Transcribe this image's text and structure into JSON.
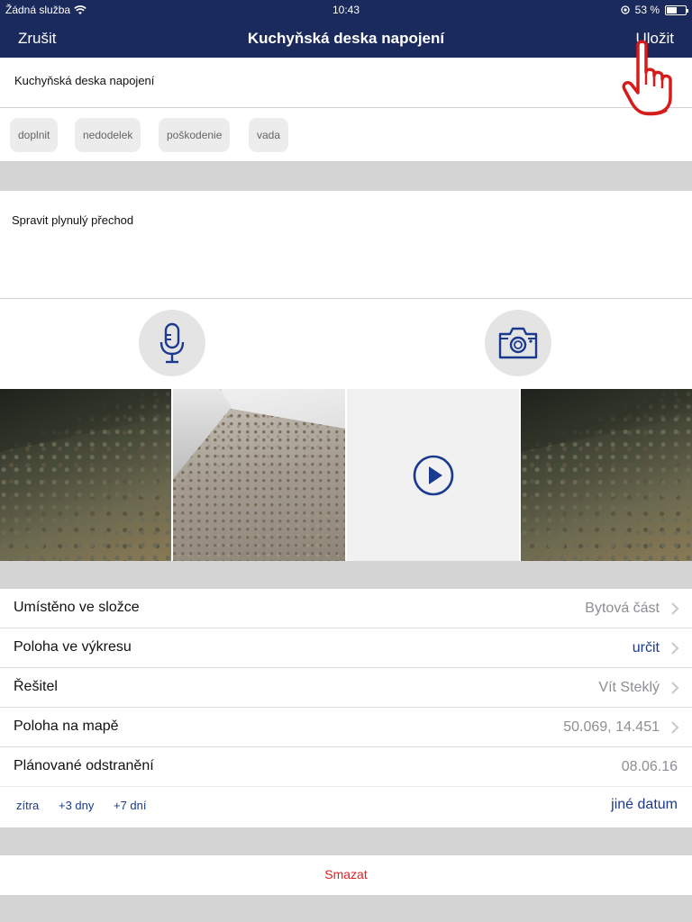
{
  "status": {
    "carrier": "Žádná služba",
    "time": "10:43",
    "battery": "53 %",
    "battery_level": 0.53
  },
  "nav": {
    "cancel": "Zrušit",
    "title": "Kuchyňská deska napojení",
    "save": "Uložit"
  },
  "item_title": "Kuchyňská deska napojení",
  "tags": [
    "doplnit",
    "nedodelek",
    "poškodenie",
    "vada"
  ],
  "description": "Spravit plynulý přechod",
  "rows": [
    {
      "label": "Umístěno ve složce",
      "value": "Bytová část"
    },
    {
      "label": "Poloha ve výkresu",
      "value": "určit"
    },
    {
      "label": "Řešitel",
      "value": "Vít Steklý"
    },
    {
      "label": "Poloha na mapě",
      "value": "50.069, 14.451"
    },
    {
      "label": "Plánované odstranění",
      "value": "08.06.16"
    }
  ],
  "quick_dates": [
    "zítra",
    "+3 dny",
    "+7 dní",
    "jiné datum"
  ],
  "delete": "Smazat",
  "colors": {
    "navbar": "#1b2a5c",
    "accent": "#1b3a8f",
    "danger": "#e02020"
  },
  "icons": [
    "wifi-icon",
    "location-icon",
    "battery-icon",
    "pointing-hand-icon",
    "microphone-icon",
    "camera-icon",
    "play-icon",
    "chevron-right-icon"
  ]
}
